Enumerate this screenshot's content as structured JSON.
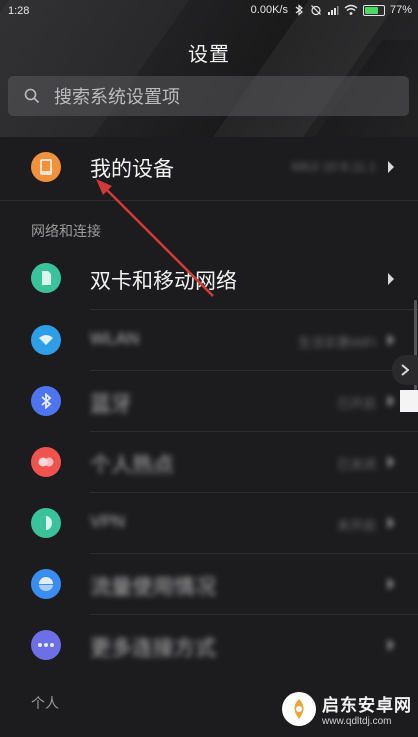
{
  "status_bar": {
    "time": "1:28",
    "speed": "0.00K/s",
    "battery": "77%",
    "battery_level": 0.77,
    "icons": [
      "bluetooth-icon",
      "alarm-off-icon",
      "signal-icon",
      "wifi-icon",
      "battery-icon"
    ]
  },
  "header": {
    "title": "设置",
    "search_placeholder": "搜索系统设置项"
  },
  "my_device": {
    "label": "我的设备",
    "value": "MIUI 10 8.11.1"
  },
  "sections": {
    "network": "网络和连接",
    "personal": "个人"
  },
  "network_items": [
    {
      "label": "双卡和移动网络",
      "value": "",
      "icon": "sim-card-icon",
      "color": "#3ac29a"
    },
    {
      "label": "WLAN",
      "value": "生活实惠WiFi",
      "icon": "wifi-icon",
      "color": "#2f9ee8"
    },
    {
      "label": "蓝牙",
      "value": "已开启",
      "icon": "bluetooth-icon",
      "color": "#4e74f0"
    },
    {
      "label": "个人热点",
      "value": "已关闭",
      "icon": "hotspot-icon",
      "color": "#f0524e"
    },
    {
      "label": "VPN",
      "value": "未开启",
      "icon": "vpn-icon",
      "color": "#3ac29a"
    },
    {
      "label": "流量使用情况",
      "value": "",
      "icon": "data-usage-icon",
      "color": "#3a8cf0"
    },
    {
      "label": "更多连接方式",
      "value": "",
      "icon": "more-icon",
      "color": "#6d6fe6"
    }
  ],
  "watermark": {
    "title": "启东安卓网",
    "url": "www.qdltdj.com"
  },
  "colors": {
    "accent_red": "#d23a3a",
    "my_device_icon": "#f2913b"
  }
}
